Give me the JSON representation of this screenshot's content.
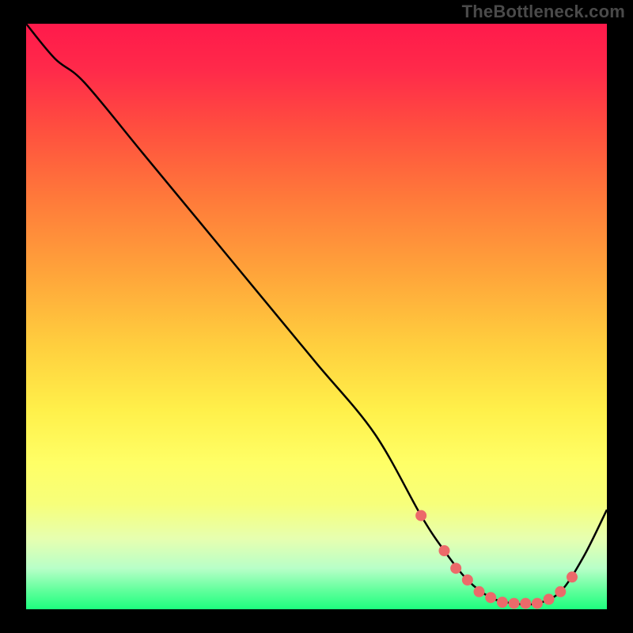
{
  "watermark": "TheBottleneck.com",
  "colors": {
    "background": "#000000",
    "curve_stroke": "#000000",
    "marker_fill": "#ec6a6a",
    "marker_stroke": "#ec6a6a"
  },
  "chart_data": {
    "type": "line",
    "title": "",
    "xlabel": "",
    "ylabel": "",
    "xlim": [
      0,
      100
    ],
    "ylim": [
      0,
      100
    ],
    "series": [
      {
        "name": "bottleneck-curve",
        "x": [
          0,
          5,
          10,
          20,
          30,
          40,
          50,
          60,
          68,
          72,
          76,
          80,
          84,
          88,
          92,
          96,
          100
        ],
        "y": [
          100,
          94,
          90,
          78,
          66,
          54,
          42,
          30,
          16,
          10,
          5,
          2,
          1,
          1,
          3,
          9,
          17
        ]
      }
    ],
    "markers": {
      "name": "highlight-points",
      "x": [
        68,
        72,
        74,
        76,
        78,
        80,
        82,
        84,
        86,
        88,
        90,
        92,
        94
      ],
      "y": [
        16,
        10,
        7,
        5,
        3,
        2,
        1.2,
        1,
        1,
        1,
        1.7,
        3,
        5.5
      ]
    }
  }
}
